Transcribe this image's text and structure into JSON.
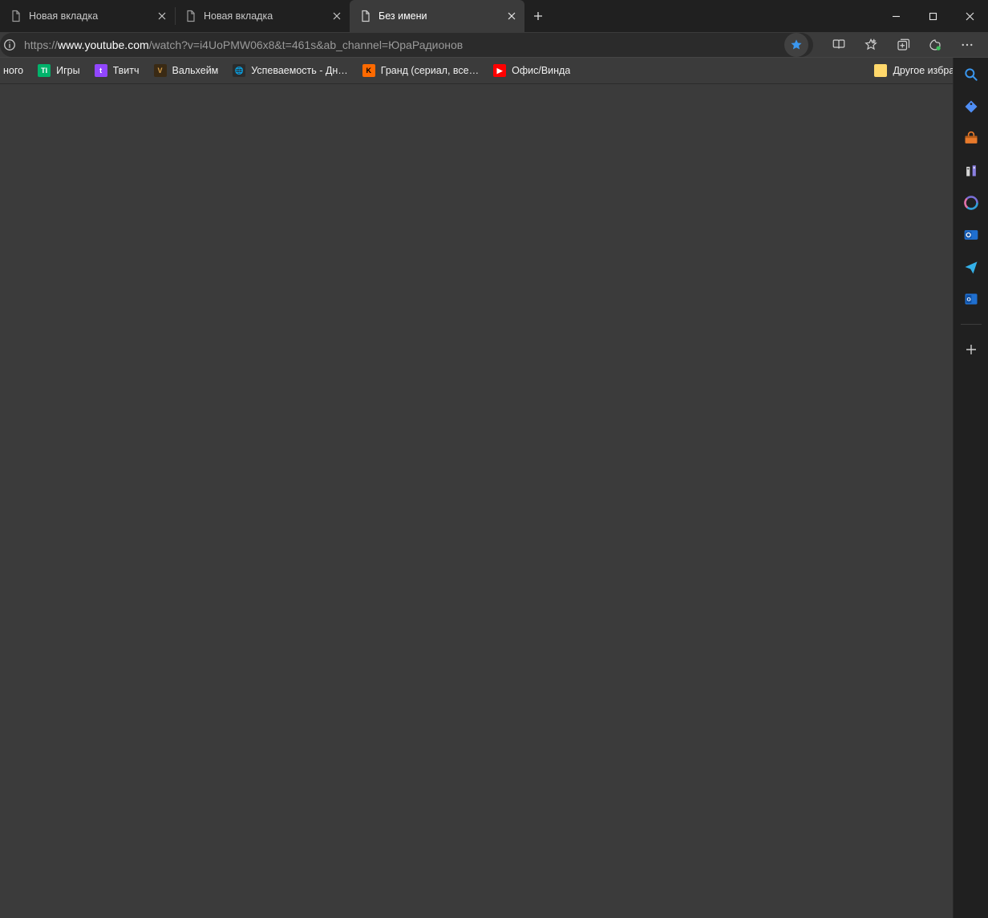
{
  "tabs": [
    {
      "title": "Новая вкладка",
      "active": false
    },
    {
      "title": "Новая вкладка",
      "active": false
    },
    {
      "title": "Без имени",
      "active": true
    }
  ],
  "addressbar": {
    "url_scheme": "https://",
    "url_host": "www.youtube.com",
    "url_path": "/watch?v=i4UoPMW06x8&t=461s&ab_channel=ЮраРадионов"
  },
  "bookmarks": {
    "partial_first": "ного",
    "items": [
      {
        "label": "Игры",
        "favicon_bg": "#00b36b",
        "favicon_text": "TI",
        "favicon_fg": "#ffffff"
      },
      {
        "label": "Твитч",
        "favicon_bg": "#9146ff",
        "favicon_text": "t",
        "favicon_fg": "#ffffff"
      },
      {
        "label": "Вальхейм",
        "favicon_bg": "#3a2a14",
        "favicon_text": "V",
        "favicon_fg": "#d8a04b"
      },
      {
        "label": "Успеваемость - Дн…",
        "favicon_bg": "#2b2b2b",
        "favicon_text": "🌐",
        "favicon_fg": "#6fb4ff"
      },
      {
        "label": "Гранд (сериал, все…",
        "favicon_bg": "#ff6a00",
        "favicon_text": "K",
        "favicon_fg": "#000000"
      },
      {
        "label": "Офис/Винда",
        "favicon_bg": "#ff0000",
        "favicon_text": "▶",
        "favicon_fg": "#ffffff"
      }
    ],
    "other_label": "Другое избранное"
  },
  "sidebar_icons": [
    "search-icon",
    "coupons-icon",
    "shopping-icon",
    "games-icon",
    "microsoft365-icon",
    "outlook-icon",
    "send-icon",
    "office-icon"
  ]
}
